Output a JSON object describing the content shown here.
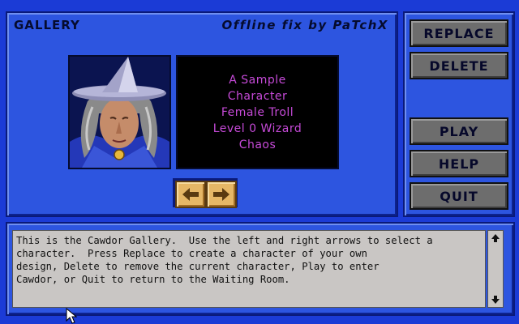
{
  "gallery": {
    "title": "GALLERY",
    "credit": "Offline fix by PaTchX"
  },
  "character": {
    "lines": [
      "A Sample",
      "Character",
      "Female Troll",
      "Level 0 Wizard",
      "Chaos"
    ],
    "portrait": "witch-portrait"
  },
  "navigation": {
    "prev_icon": "arrow-left-icon",
    "next_icon": "arrow-right-icon"
  },
  "side_menu": {
    "replace": "REPLACE",
    "delete": "DELETE",
    "play": "PLAY",
    "help": "HELP",
    "quit": "QUIT"
  },
  "description": {
    "text": "This is the Cawdor Gallery.  Use the left and right arrows to select a\ncharacter.  Press Replace to create a character of your own\ndesign, Delete to remove the current character, Play to enter\nCawdor, or Quit to return to the Waiting Room."
  },
  "colors": {
    "background": "#1b3bd6",
    "panel": "#2d55e0",
    "info_text": "#c64ad8",
    "button_gray": "#6d6d6d",
    "arrow_button": "#e6b766"
  }
}
